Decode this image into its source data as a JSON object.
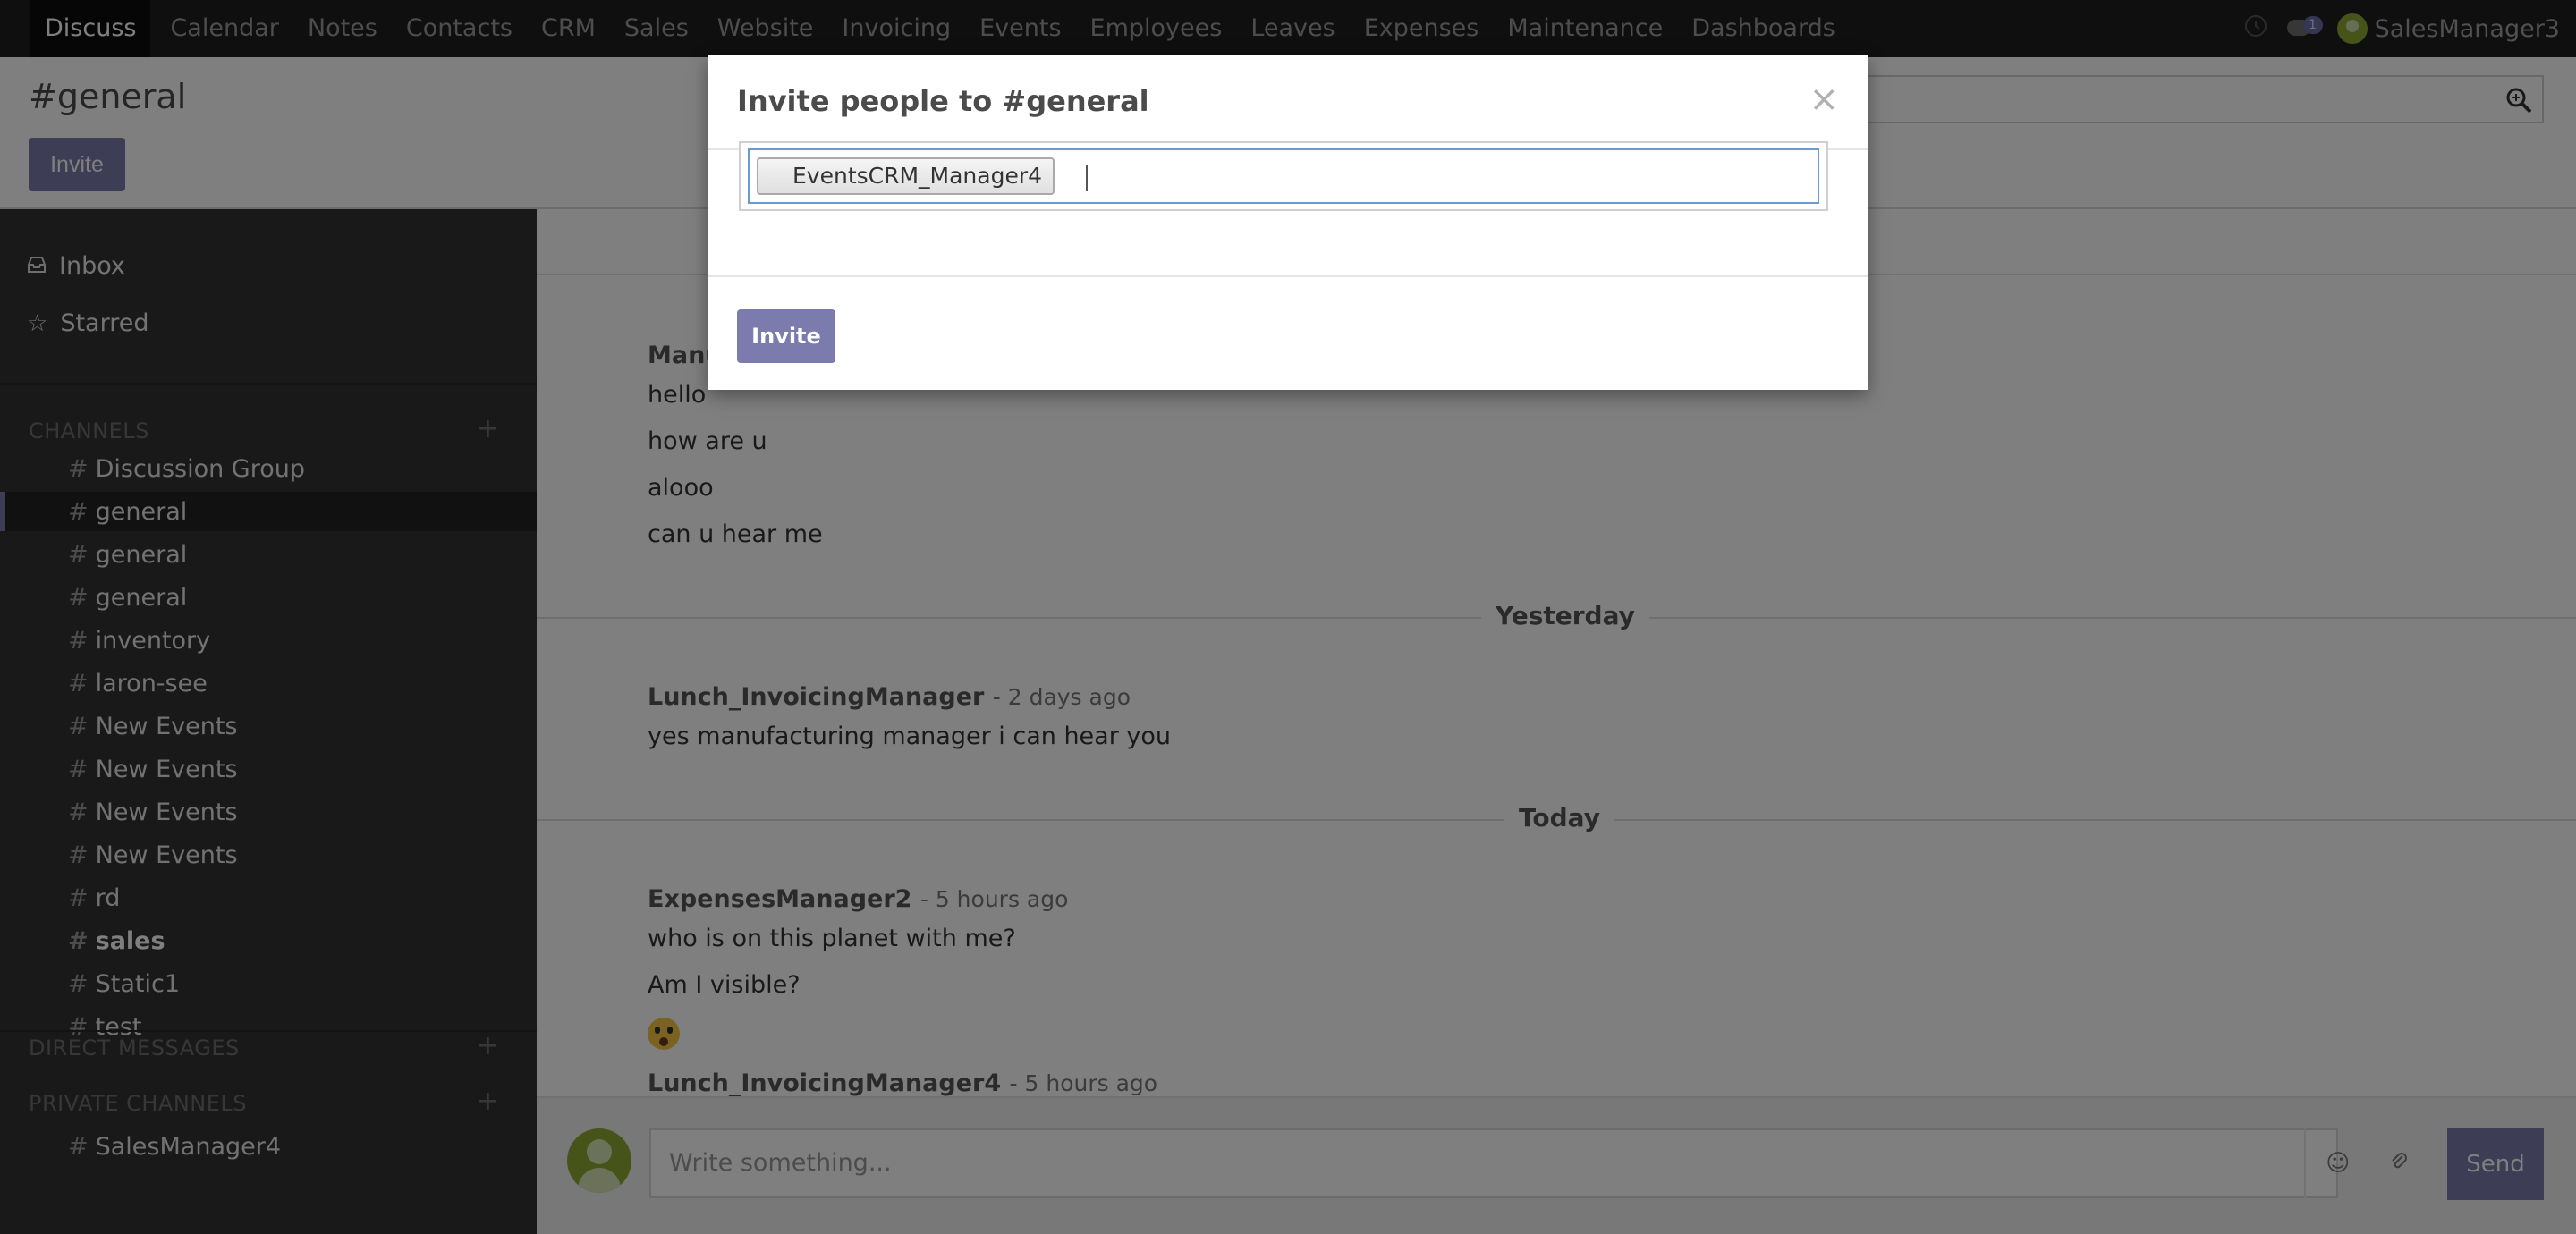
{
  "navbar": {
    "apps": [
      "Discuss",
      "Calendar",
      "Notes",
      "Contacts",
      "CRM",
      "Sales",
      "Website",
      "Invoicing",
      "Events",
      "Employees",
      "Leaves",
      "Expenses",
      "Maintenance",
      "Dashboards"
    ],
    "active_app": "Discuss",
    "chat_badge": "1",
    "user_name": "SalesManager3"
  },
  "control_panel": {
    "breadcrumb": "#general",
    "invite_label": "Invite"
  },
  "sidebar": {
    "inbox": "Inbox",
    "starred": "Starred",
    "channels_heading": "CHANNELS",
    "channels": [
      {
        "name": "Discussion Group"
      },
      {
        "name": "general",
        "active": true
      },
      {
        "name": "general"
      },
      {
        "name": "general"
      },
      {
        "name": "inventory"
      },
      {
        "name": "laron-see"
      },
      {
        "name": "New Events"
      },
      {
        "name": "New Events"
      },
      {
        "name": "New Events"
      },
      {
        "name": "New Events"
      },
      {
        "name": "rd"
      },
      {
        "name": "sales",
        "bold": true
      },
      {
        "name": "Static1"
      },
      {
        "name": "test"
      }
    ],
    "direct_heading": "DIRECT MESSAGES",
    "private_heading": "PRIVATE CHANNELS",
    "private_channels": [
      {
        "name": "SalesManager4"
      }
    ]
  },
  "thread": {
    "first_author_partial": "Manu",
    "first_messages": [
      "hello",
      "how are u",
      "alooo",
      "can u hear me"
    ],
    "day_yesterday": "Yesterday",
    "msg2_author": "Lunch_InvoicingManager",
    "msg2_date": "- 2 days ago",
    "msg2_text": "yes manufacturing manager i can hear you",
    "day_today": "Today",
    "msg3_author": "ExpensesManager2",
    "msg3_date": "- 5 hours ago",
    "msg3_lines": [
      "who is on this planet with me?",
      "Am I visible?"
    ],
    "msg4_author": "Lunch_InvoicingManager4",
    "msg4_date": "- 5 hours ago"
  },
  "composer": {
    "placeholder": "Write something...",
    "send_label": "Send"
  },
  "modal": {
    "title": "Invite people to #general",
    "close_symbol": "×",
    "tag_label": "EventsCRM_Manager4",
    "invite_label": "Invite"
  }
}
